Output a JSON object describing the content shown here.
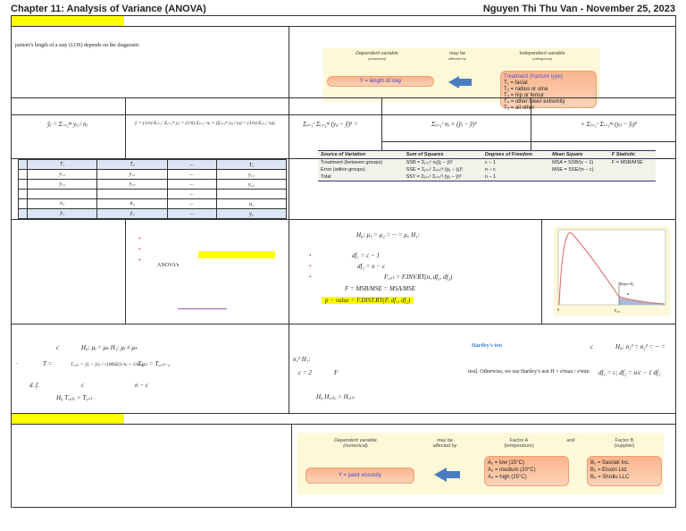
{
  "header": {
    "title": "Chapter 11: Analysis of Variance (ANOVA)",
    "author_date": "Nguyen Thi Thu Van -  November 25, 2023"
  },
  "intro": {
    "text": "patient’s length of a stay (LOS) depends on the diagnostic"
  },
  "diagram1": {
    "dependent": "Dependent variable",
    "dependent_sub": "(numerical)",
    "may_be": "may be",
    "affected_by": "affected by",
    "independent": "Independent variable",
    "independent_sub": "(categorical)",
    "y_label": "Y = length of stay",
    "treatment_title": "Treatment (fracture type)",
    "treatments": [
      "T₁ = facial",
      "T₂ = radius or ulna",
      "T₃ = hip or femur",
      "T₄ = other lower extremity",
      "T₅ = all other"
    ]
  },
  "formulas": {
    "group_mean": "ȳⱼ = Σᵢ₌₁ⁿʲ yᵢⱼ / nⱼ",
    "grand_mean": "ȳ = (1/n) Σⱼ₌₁ᶜ Σᵢ₌₁ⁿʲ yᵢⱼ = (1/n) Σⱼ₌₁ᶜ nⱼ × (Σᵢ₌₁ⁿʲ yᵢⱼ / nⱼ) = (1/n) Σⱼ₌₁ᶜ nⱼȳⱼ",
    "sst": "Σⱼ₌₁ᶜ Σᵢ₌₁ⁿʲ (yᵢⱼ − ȳ)² =",
    "ssb": "Σⱼ₌₁ᶜ nⱼ × (ȳⱼ − ȳ)²",
    "sse": "+ Σⱼ₌₁ᶜ Σᵢ₌₁ⁿʲ (yᵢⱼ − ȳⱼ)²"
  },
  "data_table": {
    "rows": [
      [
        "",
        "T₁",
        "T₂",
        "...",
        "T꜀"
      ],
      [
        "",
        "y₁₁",
        "y₁₂",
        "...",
        "y₁꜀"
      ],
      [
        "",
        "y₂₁",
        "y₂₂",
        "...",
        "y₂꜀"
      ],
      [
        "",
        "",
        "",
        "...",
        ""
      ],
      [
        "",
        "n₁",
        "n₂",
        "...",
        "n꜀"
      ],
      [
        "",
        "ȳ₁",
        "ȳ₂",
        "...",
        "ȳ꜀"
      ]
    ]
  },
  "anova_table": {
    "headers": [
      "Source of Variation",
      "Sum of Squares",
      "Degrees of Freedom",
      "Mean Square",
      "F Statistic"
    ],
    "rows": [
      [
        "Treatment (between groups)",
        "SSB = Σⱼ₌₁ᶜ nⱼ(ȳⱼ − ȳ)²",
        "c − 1",
        "MSA = SSB/(c − 1)",
        "F = MSB/MSE"
      ],
      [
        "Error (within groups)",
        "SSE = Σⱼ₌₁ᶜ Σᵢ₌₁ⁿʲ (yᵢⱼ − ȳⱼ)²",
        "n − c",
        "MSE = SSE/(n − c)",
        ""
      ],
      [
        "Total",
        "SST = Σⱼ₌₁ᶜ Σᵢ₌₁ⁿʲ (yᵢⱼ − ȳ)²",
        "n − 1",
        "",
        ""
      ]
    ]
  },
  "test": {
    "anova_s": "ANOVA’s",
    "h0": "H₀: μ₁ = μ₂ = ··· = μ꜀     H₁:",
    "df1": "df₁ = c − 1",
    "df2": "df₂ = n − c",
    "fcrit": "F꜀ᵣᵢₜ = F.INV.RT(α, df₁, df₂)",
    "f": "F = MSB/MSE = MSA/MSE",
    "pvalue": "p − value = F.DIST.RT(F, df₁, df₂)",
    "chart_reject": "Reject H₀",
    "chart_alpha": "α",
    "chart_zero": "0",
    "chart_fcrit": "F꜀ᵣᵢₜ"
  },
  "tukey": {
    "c": "c",
    "hyp": "H₀: μⱼ = μₖ  H₁: μⱼ ≠ μₖ",
    "t": "T =",
    "tcalc": "T꜀ₐₗ꜀ = |ȳⱼ − ȳₖ| / √(MSE(1/nⱼ + 1/nₖ))",
    "tcrit": "T꜀ᵣᵢₜ = T꜀,ₙ₋꜀",
    "df": "d. f.",
    "c2": "c",
    "nc": "n − c",
    "reject": "H₀   T꜀ₐₗ꜀ > T꜀ᵣᵢₜ"
  },
  "hartley": {
    "title": "Hartley’s test",
    "c": "c",
    "hyp": "H₀: σ₁² = σ₂² = ··· =",
    "hyp2": "σ꜀²  H₁:",
    "c2": "c = 2",
    "f": "F",
    "text": "test]. Otherwise, we use Hartley’s test H = s²max / s²min",
    "df": "df₁ = c; df₂ = n/c − 1  df₂",
    "reject": "H₀   H꜀ₐₗ꜀ > H꜀ᵣᵢₜ"
  },
  "diagram2": {
    "dependent": "Dependent variable",
    "dependent_sub": "(numerical)",
    "may_be": "may be",
    "affected_by": "affected by",
    "factor_a": "Factor A",
    "factor_a_sub": "(temperature)",
    "and": "and",
    "factor_b": "Factor B",
    "factor_b_sub": "(supplier)",
    "y_label": "Y = paint viscosity",
    "a_levels": [
      "A₁ = low (15°C)",
      "A₂ = medium (20°C)",
      "A₃ = high (25°C)"
    ],
    "b_levels": [
      "B₁ = Sasnak Inc.",
      "B₂ = Etsoin Ltd.",
      "B₃ = Shrdlu LLC"
    ]
  }
}
